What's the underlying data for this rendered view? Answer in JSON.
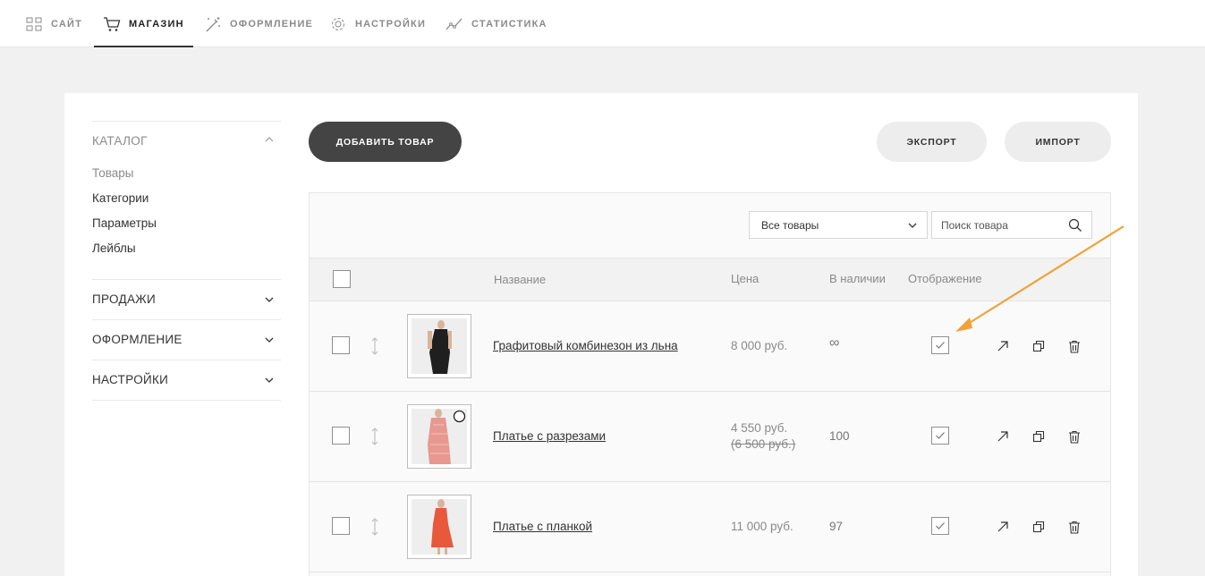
{
  "nav": {
    "items": [
      {
        "label": "САЙТ",
        "icon": "grid-icon"
      },
      {
        "label": "МАГАЗИН",
        "icon": "cart-icon",
        "active": true
      },
      {
        "label": "ОФОРМЛЕНИЕ",
        "icon": "magic-wand-icon"
      },
      {
        "label": "НАСТРОЙКИ",
        "icon": "gear-icon"
      },
      {
        "label": "СТАТИСТИКА",
        "icon": "chart-line-icon"
      }
    ]
  },
  "sidebar": {
    "catalog": {
      "title": "КАТАЛОГ",
      "links": [
        "Товары",
        "Категории",
        "Параметры",
        "Лейблы"
      ]
    },
    "sections": [
      "ПРОДАЖИ",
      "ОФОРМЛЕНИЕ",
      "НАСТРОЙКИ"
    ]
  },
  "toolbar": {
    "add_label": "ДОБАВИТЬ ТОВАР",
    "export_label": "ЭКСПОРТ",
    "import_label": "ИМПОРТ"
  },
  "filters": {
    "select_value": "Все товары",
    "search_placeholder": "Поиск товара"
  },
  "table": {
    "columns": {
      "name": "Название",
      "price": "Цена",
      "stock": "В наличии",
      "visibility": "Отображение"
    },
    "rows": [
      {
        "name": "Графитовый комбинезон из льна",
        "price": "8 000 руб.",
        "old_price": "",
        "stock": "∞",
        "visible": true
      },
      {
        "name": "Платье с разрезами",
        "price": "4 550 руб.",
        "old_price": "(6 500 руб.)",
        "stock": "100",
        "visible": true
      },
      {
        "name": "Платье с планкой",
        "price": "11 000 руб.",
        "old_price": "",
        "stock": "97",
        "visible": true
      }
    ]
  },
  "colors": {
    "accent_arrow": "#f0a23a",
    "primary_button": "#444444"
  }
}
